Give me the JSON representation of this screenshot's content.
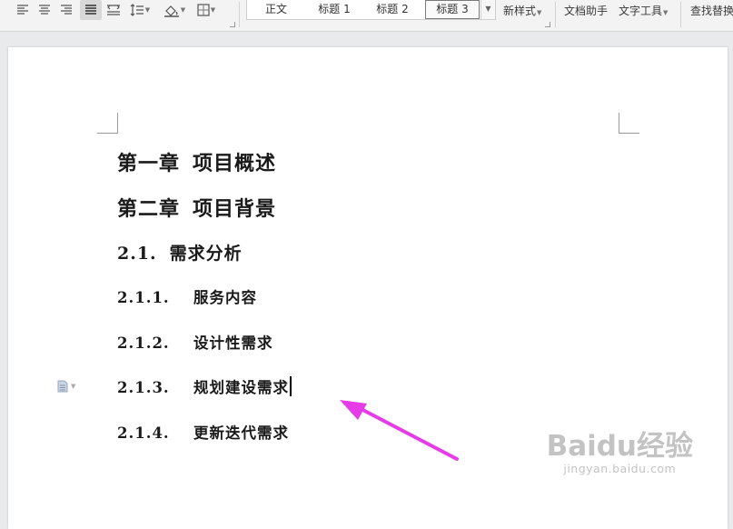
{
  "toolbar": {
    "styles": [
      {
        "label": "正文",
        "selected": false
      },
      {
        "label": "标题 1",
        "selected": false
      },
      {
        "label": "标题 2",
        "selected": false
      },
      {
        "label": "标题 3",
        "selected": true
      }
    ],
    "new_style_label": "新样式",
    "doc_assistant_label": "文档助手",
    "text_tools_label": "文字工具",
    "find_replace_label": "查找替换"
  },
  "document": {
    "headings": [
      {
        "level": 1,
        "number": "第一章",
        "text": "项目概述"
      },
      {
        "level": 1,
        "number": "第二章",
        "text": "项目背景"
      },
      {
        "level": 2,
        "number": "2.1.",
        "text": "需求分析"
      },
      {
        "level": 3,
        "number": "2.1.1.",
        "text": "服务内容"
      },
      {
        "level": 3,
        "number": "2.1.2.",
        "text": "设计性需求"
      },
      {
        "level": 3,
        "number": "2.1.3.",
        "text": "规划建设需求",
        "cursor": true
      },
      {
        "level": 3,
        "number": "2.1.4.",
        "text": "更新迭代需求"
      }
    ]
  },
  "annotation": {
    "arrow_color": "#e63ce8"
  },
  "watermark": {
    "logo": "Baidu经验",
    "url": "jingyan.baidu.com"
  }
}
